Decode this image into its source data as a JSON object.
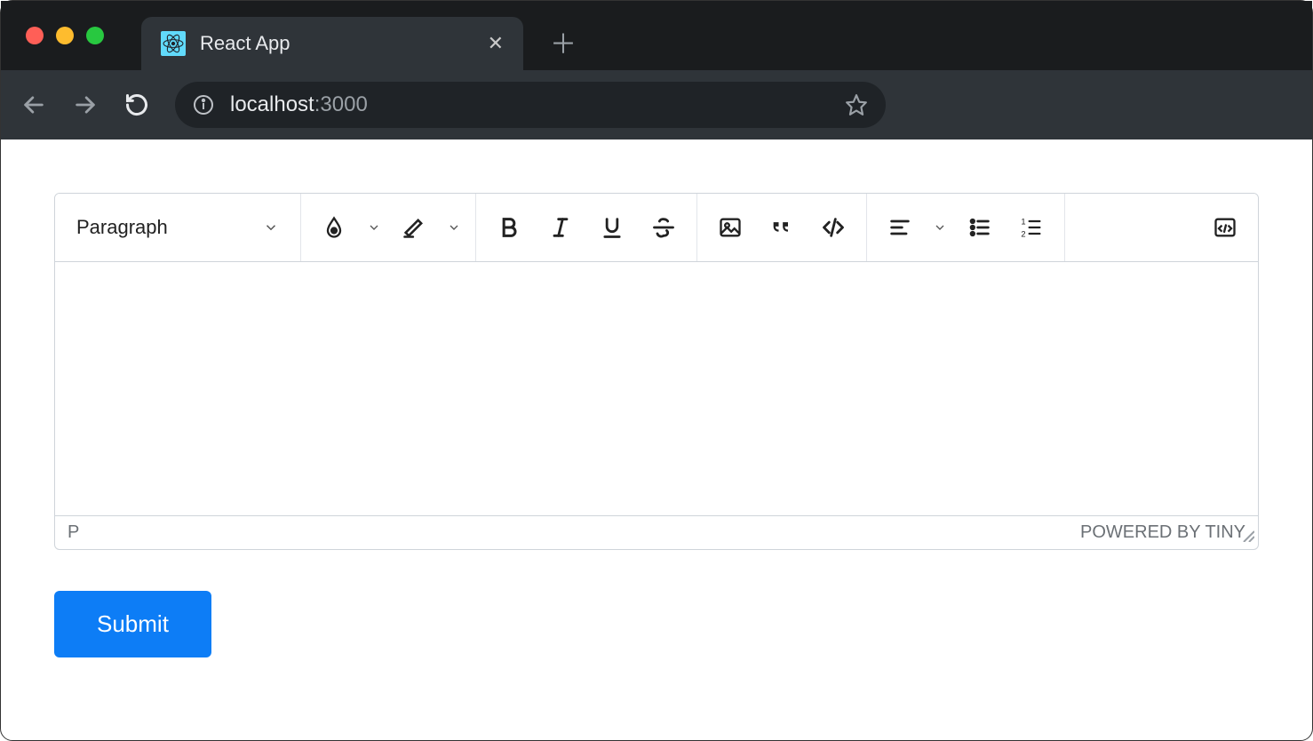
{
  "browser": {
    "tab_title": "React App",
    "url_host": "localhost",
    "url_port": ":3000"
  },
  "editor": {
    "toolbar": {
      "format_label": "Paragraph"
    },
    "status_path": "P",
    "powered_by": "POWERED BY TINY"
  },
  "buttons": {
    "submit": "Submit"
  }
}
